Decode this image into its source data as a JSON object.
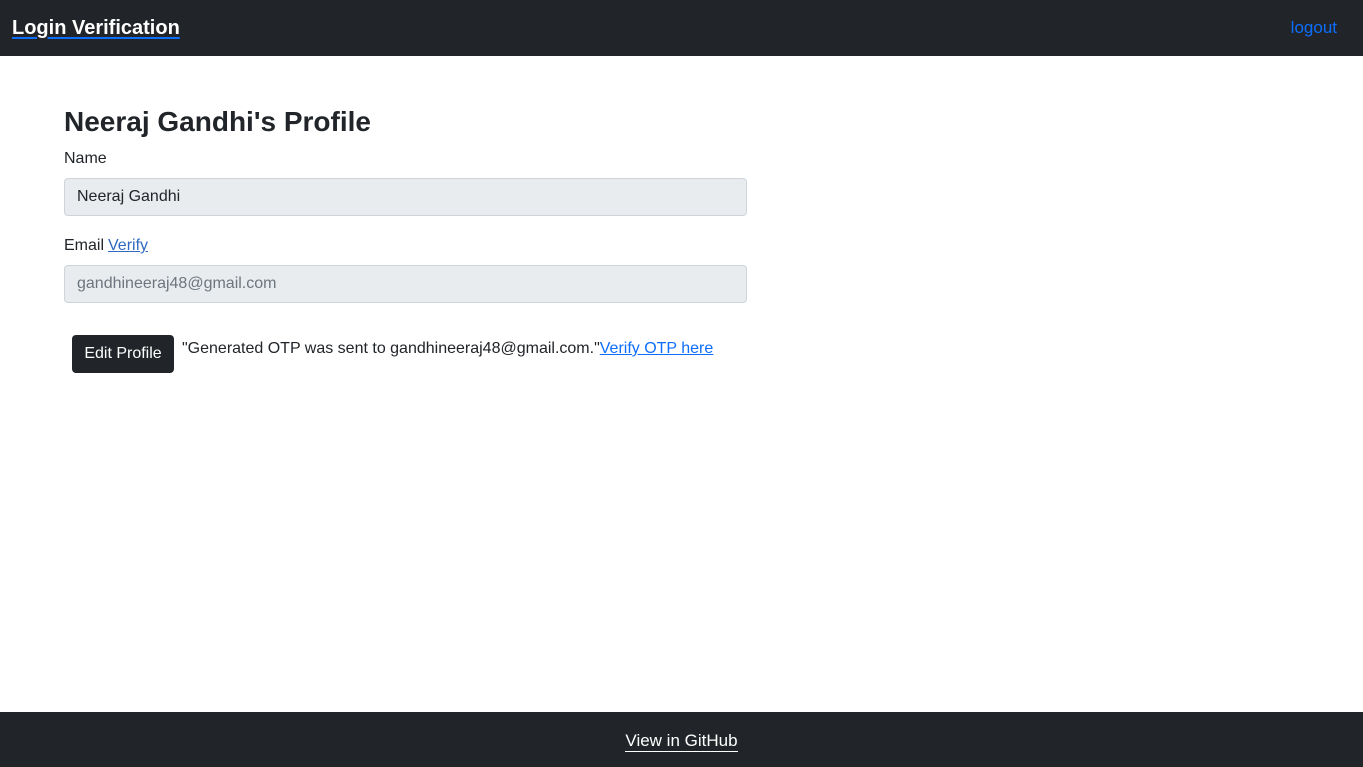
{
  "navbar": {
    "brand": "Login Verification",
    "logout_label": "logout"
  },
  "profile": {
    "title": "Neeraj Gandhi's Profile",
    "name_label": "Name",
    "name_value": "Neeraj Gandhi",
    "email_label": "Email",
    "email_verify_label": "Verify",
    "email_value": "gandhineeraj48@gmail.com",
    "edit_button_label": "Edit Profile",
    "otp_message": "\"Generated OTP was sent to gandhineeraj48@gmail.com.\"",
    "otp_link_label": "Verify OTP here"
  },
  "footer": {
    "github_label": "View in GitHub"
  },
  "colors": {
    "navbar_bg": "#212529",
    "link": "#0d6efd",
    "input_bg": "#e9ecef"
  }
}
